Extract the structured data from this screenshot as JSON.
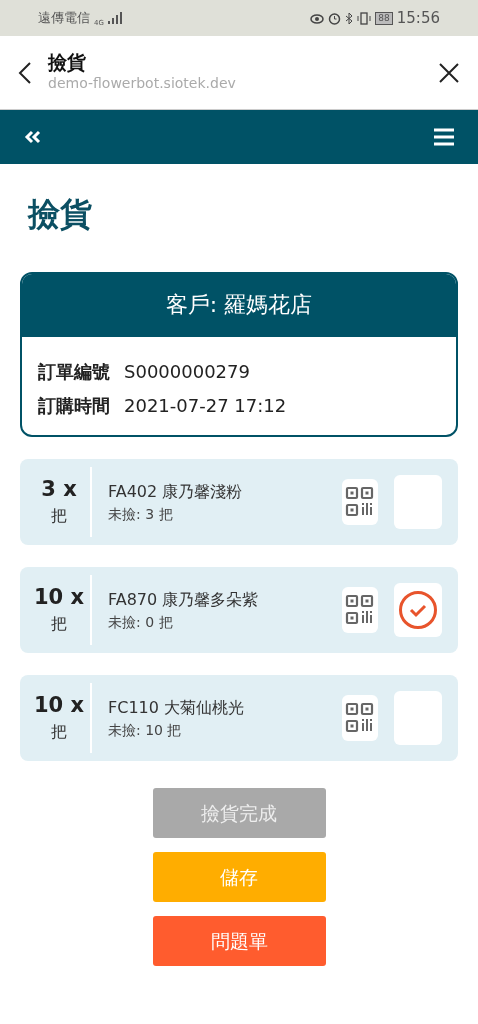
{
  "status_bar": {
    "carrier": "遠傳電信",
    "network": "4G",
    "battery": "88",
    "time": "15:56"
  },
  "browser": {
    "title": "撿貨",
    "url": "demo-flowerbot.siotek.dev"
  },
  "page_title": "撿貨",
  "order": {
    "customer": "客戶: 羅媽花店",
    "fields": [
      {
        "label": "訂單編號",
        "value": "S0000000279"
      },
      {
        "label": "訂購時間",
        "value": "2021-07-27 17:12"
      }
    ]
  },
  "items": [
    {
      "quantity": "3 x",
      "unit": "把",
      "name": "FA402 康乃馨淺粉",
      "remaining": "未撿: 3 把",
      "checked": false
    },
    {
      "quantity": "10 x",
      "unit": "把",
      "name": "FA870 康乃馨多朵紫",
      "remaining": "未撿: 0 把",
      "checked": true
    },
    {
      "quantity": "10 x",
      "unit": "把",
      "name": "FC110 大菊仙桃光",
      "remaining": "未撿: 10 把",
      "checked": false
    }
  ],
  "buttons": [
    {
      "label": "撿貨完成",
      "color": "#a9a9a9",
      "disabled": true
    },
    {
      "label": "儲存",
      "color": "#ffad00",
      "disabled": false
    },
    {
      "label": "問題單",
      "color": "#ff5c2e",
      "disabled": false
    }
  ]
}
